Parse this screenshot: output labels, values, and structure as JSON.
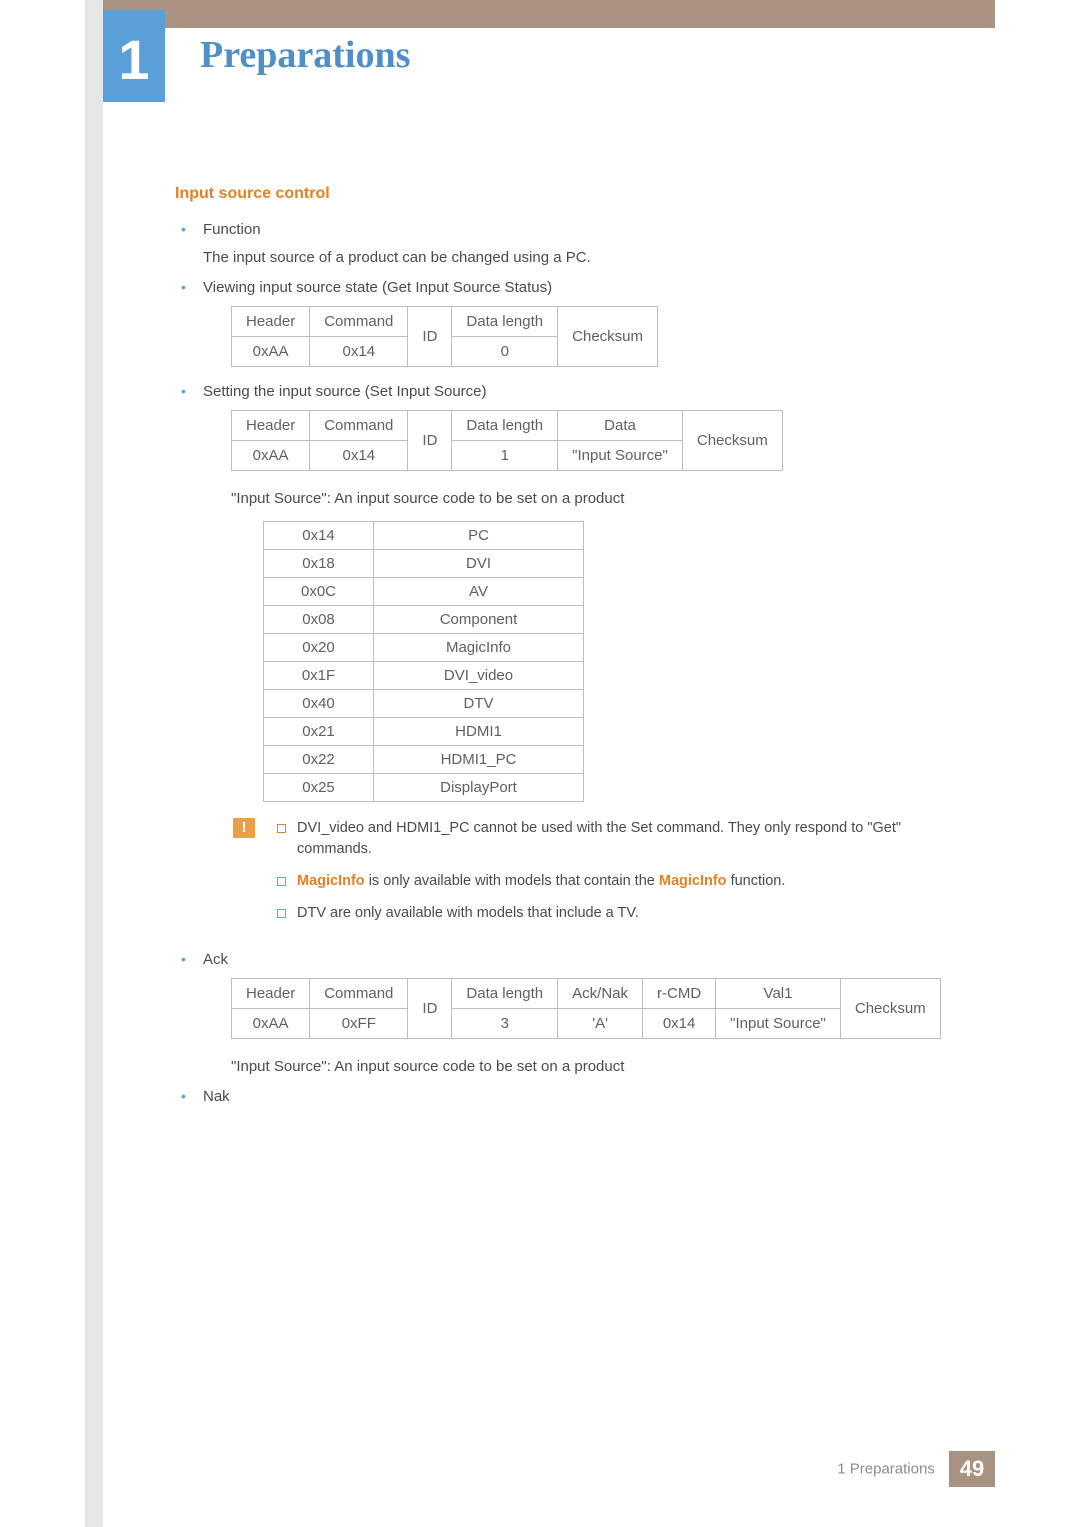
{
  "chapter": {
    "number": "1",
    "title": "Preparations"
  },
  "section": {
    "title": "Input source control"
  },
  "bullets": {
    "function_label": "Function",
    "function_desc": "The input source of a product can be changed using a PC.",
    "viewing_label": "Viewing input source state (Get Input Source Status)",
    "setting_label": "Setting the input source (Set Input Source)",
    "ack_label": "Ack",
    "nak_label": "Nak"
  },
  "table_get": {
    "headers": [
      "Header",
      "Command",
      "ID",
      "Data length",
      "Checksum"
    ],
    "row": [
      "0xAA",
      "0x14",
      "",
      "0",
      ""
    ]
  },
  "table_set": {
    "headers": [
      "Header",
      "Command",
      "ID",
      "Data length",
      "Data",
      "Checksum"
    ],
    "row": [
      "0xAA",
      "0x14",
      "",
      "1",
      "\"Input Source\"",
      ""
    ]
  },
  "explain_input_source": "\"Input Source\": An input source code to be set on a product",
  "codes": [
    {
      "v": "0x14",
      "n": "PC"
    },
    {
      "v": "0x18",
      "n": "DVI"
    },
    {
      "v": "0x0C",
      "n": "AV"
    },
    {
      "v": "0x08",
      "n": "Component"
    },
    {
      "v": "0x20",
      "n": "MagicInfo"
    },
    {
      "v": "0x1F",
      "n": "DVI_video"
    },
    {
      "v": "0x40",
      "n": "DTV"
    },
    {
      "v": "0x21",
      "n": "HDMI1"
    },
    {
      "v": "0x22",
      "n": "HDMI1_PC"
    },
    {
      "v": "0x25",
      "n": "DisplayPort"
    }
  ],
  "caution": {
    "line1": "DVI_video and HDMI1_PC cannot be used with the Set command. They only respond to \"Get\" commands.",
    "line2_a": "MagicInfo",
    "line2_b": " is only available with models that contain the ",
    "line2_c": "MagicInfo",
    "line2_d": " function.",
    "line3": "DTV are only available with models that include a TV."
  },
  "table_ack": {
    "headers": [
      "Header",
      "Command",
      "ID",
      "Data length",
      "Ack/Nak",
      "r-CMD",
      "Val1",
      "Checksum"
    ],
    "row": [
      "0xAA",
      "0xFF",
      "",
      "3",
      "'A'",
      "0x14",
      "\"Input Source\"",
      ""
    ]
  },
  "footer": {
    "text": "1 Preparations",
    "page": "49"
  }
}
